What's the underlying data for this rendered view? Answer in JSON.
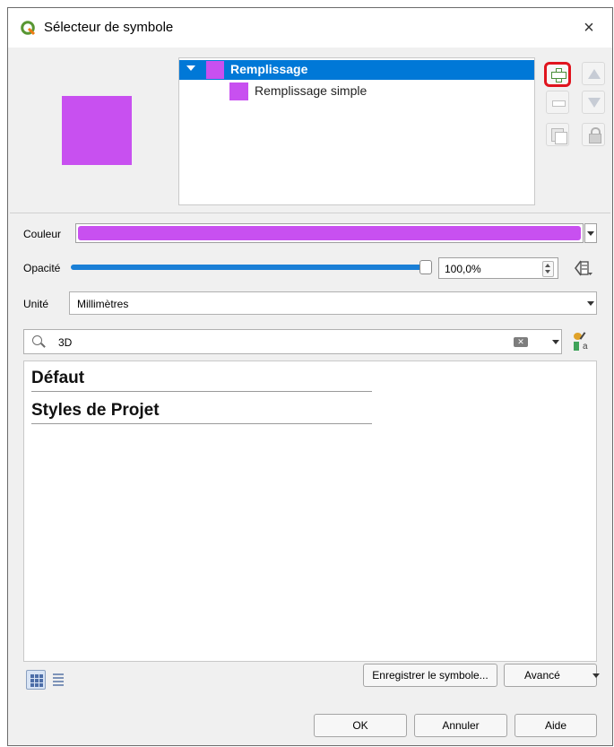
{
  "window": {
    "title": "Sélecteur de symbole",
    "close_label": "×"
  },
  "layers": [
    {
      "label": "Remplissage",
      "selected": true,
      "color": "#c850f0"
    },
    {
      "label": "Remplissage simple",
      "selected": false,
      "color": "#c850f0"
    }
  ],
  "layer_tools": {
    "add": "add-layer",
    "up": "move-up",
    "remove": "remove-layer",
    "down": "move-down",
    "duplicate": "duplicate-layer",
    "lock": "lock-layer",
    "add_highlight_color": "#e0141e"
  },
  "properties": {
    "color_label": "Couleur",
    "color_value": "#c850f0",
    "opacity_label": "Opacité",
    "opacity_value": "100,0%",
    "opacity_fraction": 1.0,
    "unit_label": "Unité",
    "unit_value": "Millimètres"
  },
  "search": {
    "value": "3D"
  },
  "groups": [
    "Défaut",
    "Styles de Projet"
  ],
  "footer": {
    "save_label": "Enregistrer le symbole...",
    "advanced_label": "Avancé",
    "ok_label": "OK",
    "cancel_label": "Annuler",
    "help_label": "Aide"
  },
  "colors": {
    "accent": "#0078d7",
    "symbol": "#c850f0",
    "slider": "#1a7fd6"
  }
}
